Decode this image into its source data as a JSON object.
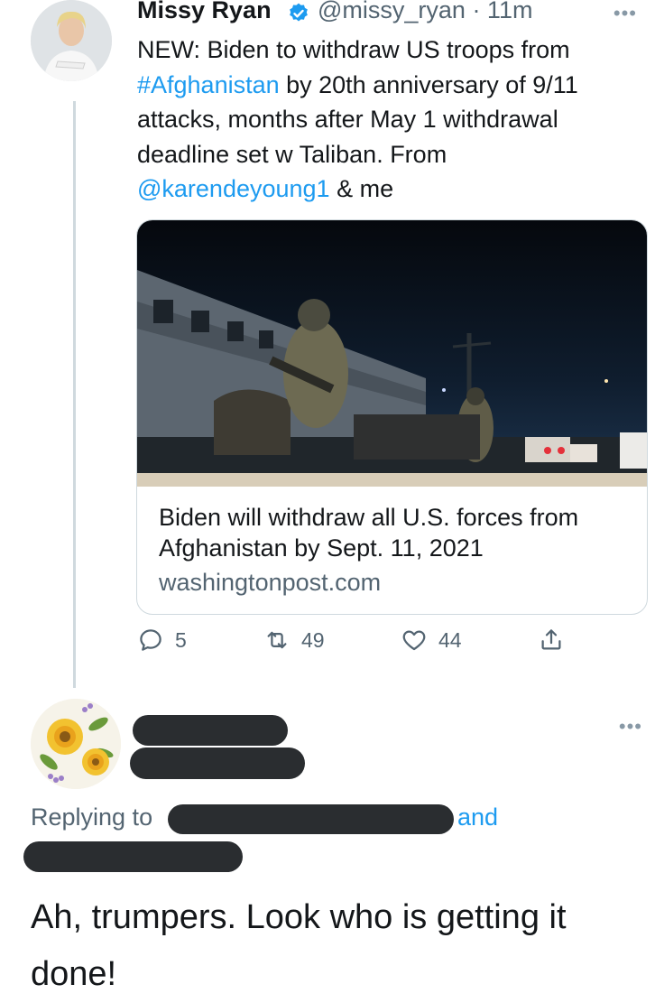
{
  "tweet": {
    "author_name": "Missy Ryan",
    "handle_time": "@missy_ryan · 11m",
    "text": {
      "part1": "NEW: Biden to withdraw US troops from ",
      "hashtag": "#Afghanistan",
      "part2": " by 20th anniversary of 9/11 attacks, months after May 1 withdrawal deadline set w Taliban. From ",
      "mention": "@karendeyoung1",
      "part3": " & me"
    },
    "card": {
      "title": "Biden will withdraw all U.S. forces from Afghanistan by Sept. 11, 2021",
      "domain": "washingtonpost.com"
    },
    "actions": {
      "replies": "5",
      "retweets": "49",
      "likes": "44"
    },
    "more_icon": "more-horizontal-icon",
    "verified_icon": "verified-badge-icon"
  },
  "reply": {
    "replying_to_label": "Replying to",
    "and_label": "and",
    "text": "Ah, trumpers. Look who is getting it done!",
    "more_icon": "more-horizontal-icon"
  },
  "colors": {
    "link": "#1d9bf0",
    "secondary_text": "#536471",
    "redaction": "#2a2d30"
  }
}
